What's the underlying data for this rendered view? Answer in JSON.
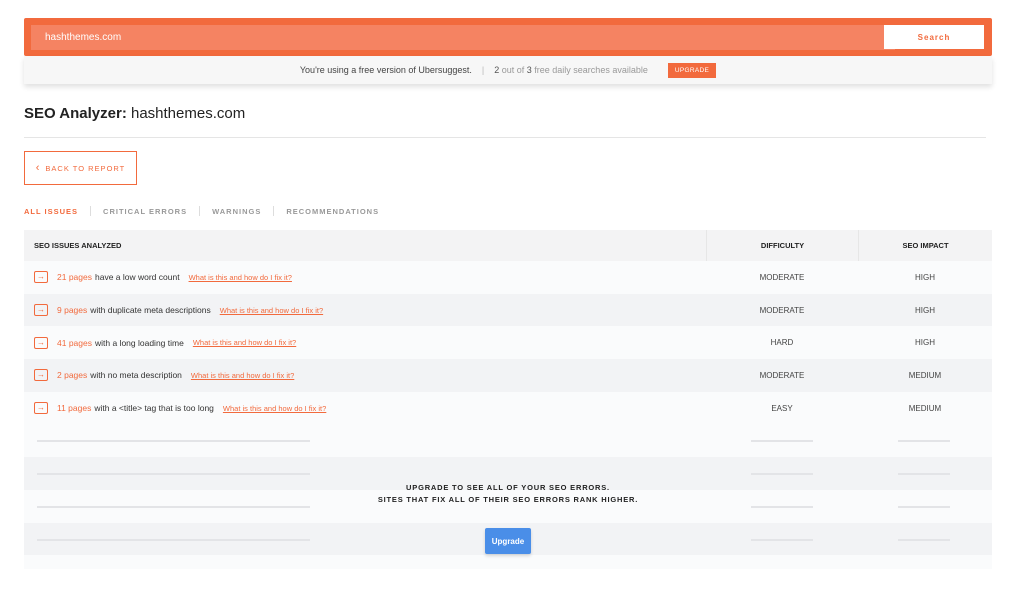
{
  "search": {
    "value": "hashthemes.com",
    "button_label": "Search"
  },
  "banner": {
    "message": "You're using a free version of Ubersuggest.",
    "used": "2",
    "out_of_text": " out of ",
    "total": "3",
    "suffix": " free daily searches available",
    "upgrade_label": "UPGRADE"
  },
  "page": {
    "title_bold": "SEO Analyzer:",
    "title_domain": " hashthemes.com",
    "back_label": "BACK TO REPORT"
  },
  "tabs": [
    {
      "label": "ALL ISSUES",
      "active": true
    },
    {
      "label": "CRITICAL ERRORS",
      "active": false
    },
    {
      "label": "WARNINGS",
      "active": false
    },
    {
      "label": "RECOMMENDATIONS",
      "active": false
    }
  ],
  "table": {
    "headers": {
      "issue": "SEO ISSUES ANALYZED",
      "difficulty": "DIFFICULTY",
      "impact": "SEO IMPACT"
    },
    "rows": [
      {
        "count": "21 pages",
        "desc": "have a low word count",
        "link": "What is this and how do I fix it?",
        "difficulty": "MODERATE",
        "impact": "HIGH"
      },
      {
        "count": "9 pages",
        "desc": "with duplicate meta descriptions",
        "link": "What is this and how do I fix it?",
        "difficulty": "MODERATE",
        "impact": "HIGH"
      },
      {
        "count": "41 pages",
        "desc": "with a long loading time",
        "link": "What is this and how do I fix it?",
        "difficulty": "HARD",
        "impact": "HIGH"
      },
      {
        "count": "2 pages",
        "desc": "with no meta description",
        "link": "What is this and how do I fix it?",
        "difficulty": "MODERATE",
        "impact": "MEDIUM"
      },
      {
        "count": "11 pages",
        "desc": "with a <title> tag that is too long",
        "link": "What is this and how do I fix it?",
        "difficulty": "EASY",
        "impact": "MEDIUM"
      }
    ]
  },
  "upsell": {
    "line1": "UPGRADE TO SEE ALL OF YOUR SEO ERRORS.",
    "line2": "SITES THAT FIX ALL OF THEIR SEO ERRORS RANK HIGHER.",
    "button_label": "Upgrade"
  },
  "colors": {
    "accent": "#f26a3d",
    "upgrade_button": "#4a8ee8"
  }
}
